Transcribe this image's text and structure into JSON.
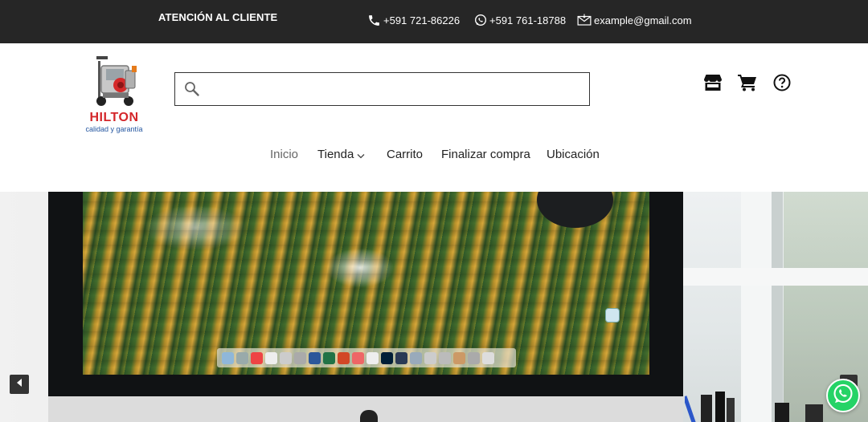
{
  "topbar": {
    "customer_service": "ATENCIÓN AL CLIENTE",
    "phone": "+591 721-86226",
    "whatsapp": "+591 761-18788",
    "email": "example@gmail.com",
    "phone_icon": "phone-icon",
    "whatsapp_icon": "whatsapp-icon",
    "email_icon": "envelope-icon"
  },
  "logo": {
    "name": "HILTON",
    "tagline": "calidad y garantía"
  },
  "search": {
    "placeholder": "",
    "value": "",
    "icon": "search-icon"
  },
  "header_icons": [
    "store-icon",
    "cart-icon",
    "help-icon"
  ],
  "nav": {
    "items": [
      {
        "label": "Inicio",
        "active": true
      },
      {
        "label": "Tienda",
        "has_dropdown": true
      },
      {
        "label": "Carrito"
      },
      {
        "label": "Finalizar compra"
      },
      {
        "label": "Ubicación"
      }
    ]
  },
  "hero": {
    "image": "imac-desktop-forest-wallpaper",
    "controls": [
      "arrow-left-icon",
      "arrow-right-icon"
    ]
  },
  "floating": {
    "whatsapp_button": "whatsapp-icon"
  },
  "colors": {
    "topbar_bg": "#262626",
    "logo_red": "#d4262a",
    "logo_blue": "#2456a0",
    "whatsapp_green": "#25d366"
  }
}
